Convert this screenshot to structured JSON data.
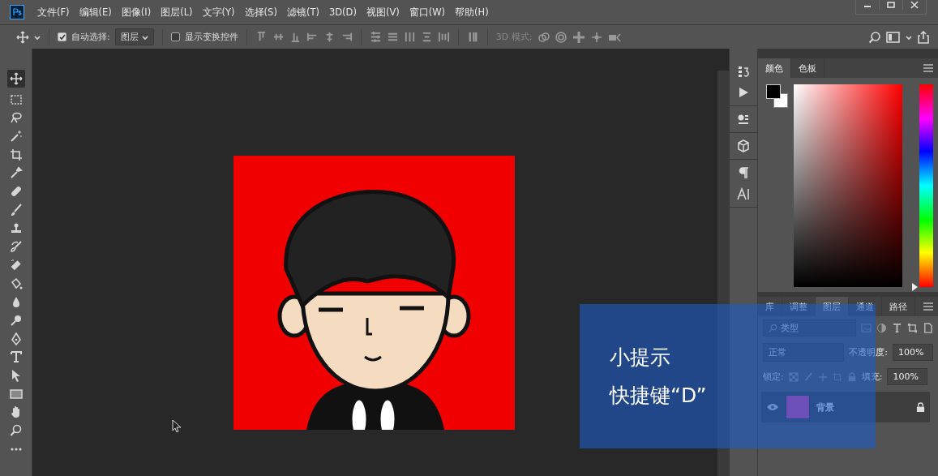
{
  "menu": [
    "文件(F)",
    "编辑(E)",
    "图像(I)",
    "图层(L)",
    "文字(Y)",
    "选择(S)",
    "滤镜(T)",
    "3D(D)",
    "视图(V)",
    "窗口(W)",
    "帮助(H)"
  ],
  "options": {
    "auto_select": {
      "label": "自动选择:",
      "checked": true
    },
    "target": "图层",
    "show_transform": {
      "label": "显示变换控件",
      "checked": false
    },
    "mode_3d_label": "3D 模式:"
  },
  "color_panel": {
    "hue_slider": {
      "level": 0
    },
    "tabs": [
      {
        "label": "颜色",
        "selected": true
      },
      {
        "label": "色板",
        "selected": false
      }
    ]
  },
  "layers_panel": {
    "tabs": [
      {
        "label": "库",
        "selected": false
      },
      {
        "label": "调整",
        "selected": false
      },
      {
        "label": "图层",
        "selected": true
      },
      {
        "label": "通道",
        "selected": false
      },
      {
        "label": "路径",
        "selected": false
      }
    ],
    "filter_placeholder": "类型",
    "blend_mode": "正常",
    "opacity_label": "不透明度:",
    "opacity": "100%",
    "lock_label": "锁定:",
    "fill_label": "填充:",
    "fill": "100%",
    "layers": [
      {
        "name": "背景",
        "visible": true,
        "locked": true,
        "selected": true
      }
    ]
  },
  "tip": {
    "title": "小提示",
    "body": "快捷键“D”"
  }
}
